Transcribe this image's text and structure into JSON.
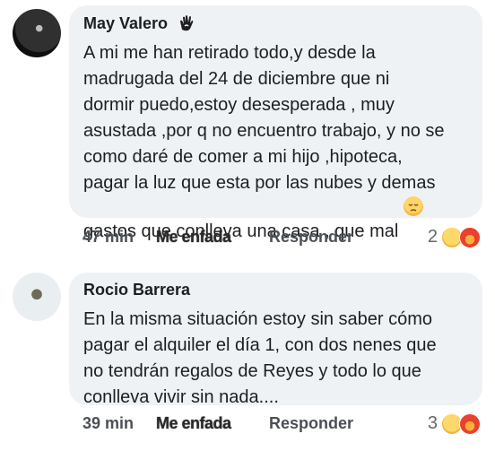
{
  "comments": [
    {
      "author": "May Valero",
      "badge_icon": "fan-badge-icon",
      "text": "A mi me han retirado todo,y desde la\nmadrugada del 24 de diciembre que ni\ndormir puedo,estoy desesperada , muy\nasustada ,por q no encuentro trabajo, y no se\ncomo daré de comer a mi hijo ,hipoteca,\npagar la luz que esta por las nubes y demas\ngastos que conlleva una casa , que mal",
      "trailing_emoji": "sad-face-emoji",
      "time": "47 min",
      "reaction_label": "Me enfada",
      "reply_label": "Responder",
      "reaction_count": "2",
      "reaction_icons": [
        "sad-reaction-icon",
        "angry-reaction-icon"
      ]
    },
    {
      "author": "Rocio Barrera",
      "text": "En la misma situación estoy sin saber cómo\npagar el alquiler el día 1, con dos nenes que\nno tendrán regalos de Reyes y todo lo que\nconlleva vivir sin nada....",
      "time": "39 min",
      "reaction_label": "Me enfada",
      "reply_label": "Responder",
      "reaction_count": "3",
      "reaction_icons": [
        "sad-reaction-icon",
        "angry-reaction-icon"
      ]
    }
  ]
}
